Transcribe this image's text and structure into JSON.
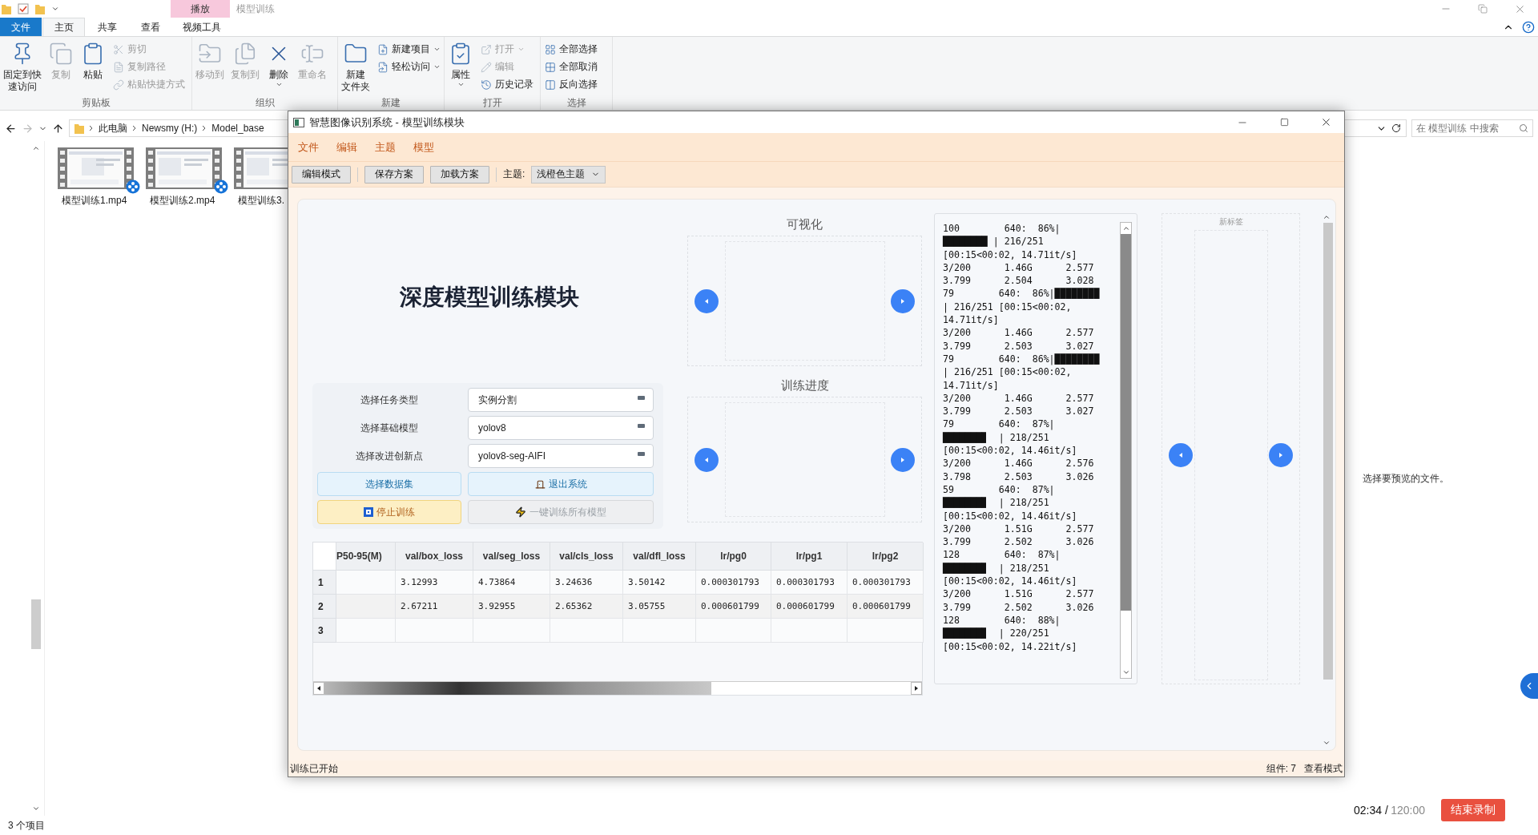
{
  "explorer": {
    "title": "模型训练",
    "context_tab": "播放",
    "tabs": [
      {
        "label": "文件",
        "kind": "file",
        "selected": false
      },
      {
        "label": "主页",
        "kind": "tab",
        "selected": true
      },
      {
        "label": "共享",
        "kind": "tab",
        "selected": false
      },
      {
        "label": "查看",
        "kind": "tab",
        "selected": false
      },
      {
        "label": "视频工具",
        "kind": "tab",
        "selected": false
      }
    ],
    "ribbon_groups": [
      {
        "label": "剪贴板",
        "items": [
          {
            "lines": [
              "固定到快",
              "速访问"
            ],
            "kind": "large",
            "disabled": false,
            "dropdown": false
          },
          {
            "label": "复制",
            "kind": "large",
            "disabled": true,
            "dropdown": false
          },
          {
            "label": "粘贴",
            "kind": "large",
            "disabled": false,
            "dropdown": false
          },
          {
            "label": "剪切",
            "kind": "small",
            "disabled": true,
            "dropdown": false
          },
          {
            "label": "复制路径",
            "kind": "small",
            "disabled": true,
            "dropdown": false
          },
          {
            "label": "粘贴快捷方式",
            "kind": "small",
            "disabled": true,
            "dropdown": false
          }
        ]
      },
      {
        "label": "组织",
        "items": [
          {
            "label": "移动到",
            "kind": "large",
            "disabled": true,
            "dropdown": false
          },
          {
            "label": "复制到",
            "kind": "large",
            "disabled": true,
            "dropdown": false
          },
          {
            "label": "删除",
            "kind": "large",
            "disabled": false,
            "dropdown": true
          },
          {
            "label": "重命名",
            "kind": "large",
            "disabled": true,
            "dropdown": false
          }
        ]
      },
      {
        "label": "新建",
        "items": [
          {
            "lines": [
              "新建",
              "文件夹"
            ],
            "kind": "large",
            "disabled": false,
            "dropdown": false
          },
          {
            "label": "新建项目",
            "kind": "small",
            "disabled": false,
            "dropdown": true
          },
          {
            "label": "轻松访问",
            "kind": "small",
            "disabled": false,
            "dropdown": true
          }
        ]
      },
      {
        "label": "打开",
        "items": [
          {
            "label": "属性",
            "kind": "large",
            "disabled": false,
            "dropdown": true
          },
          {
            "label": "打开",
            "kind": "small",
            "disabled": true,
            "dropdown": true
          },
          {
            "label": "编辑",
            "kind": "small",
            "disabled": true,
            "dropdown": false
          },
          {
            "label": "历史记录",
            "kind": "small",
            "disabled": false,
            "dropdown": false
          }
        ]
      },
      {
        "label": "选择",
        "items": [
          {
            "label": "全部选择",
            "kind": "small",
            "disabled": false,
            "dropdown": false
          },
          {
            "label": "全部取消",
            "kind": "small",
            "disabled": false,
            "dropdown": false
          },
          {
            "label": "反向选择",
            "kind": "small",
            "disabled": false,
            "dropdown": false
          }
        ]
      }
    ],
    "breadcrumbs": [
      "此电脑",
      "Newsmy (H:)",
      "Model_base"
    ],
    "search": {
      "placeholder": "在 模型训练 中搜索"
    },
    "files": [
      {
        "name": "模型训练1.mp4"
      },
      {
        "name": "模型训练2.mp4"
      },
      {
        "name": "模型训练3."
      }
    ],
    "preview_hint": "选择要预览的文件。",
    "status": "3 个项目"
  },
  "app": {
    "title": "智慧图像识别系统 - 模型训练模块",
    "menu": [
      "文件",
      "编辑",
      "主题",
      "模型"
    ],
    "toolbar": {
      "buttons": [
        "编辑模式",
        "保存方案",
        "加载方案"
      ],
      "theme_label": "主题:",
      "theme_value": "浅橙色主题"
    },
    "heading": "深度模型训练模块",
    "form": [
      {
        "label": "选择任务类型",
        "value": "实例分割"
      },
      {
        "label": "选择基础模型",
        "value": "yolov8"
      },
      {
        "label": "选择改进创新点",
        "value": "yolov8-seg-AIFI"
      }
    ],
    "actions": [
      {
        "label": "选择数据集",
        "kind": "info",
        "disabled": false
      },
      {
        "label": "退出系统",
        "kind": "info",
        "disabled": false
      },
      {
        "label": "停止训练",
        "kind": "warning",
        "disabled": false
      },
      {
        "label": "一键训练所有模型",
        "kind": "plain",
        "disabled": true
      }
    ],
    "carousels": [
      {
        "title": "可视化"
      },
      {
        "title": "训练进度"
      }
    ],
    "log": [
      "100        640:  86%|",
      "████████ | 216/251",
      "[00:15<00:02, 14.71it/s]",
      "3/200      1.46G      2.577",
      "3.799      2.504      3.028",
      "79        640:  86%|████████",
      "| 216/251 [00:15<00:02,",
      "14.71it/s]",
      "3/200      1.46G      2.577",
      "3.799      2.503      3.027",
      "79        640:  86%|████████",
      "| 216/251 [00:15<00:02,",
      "14.71it/s]",
      "3/200      1.46G      2.577",
      "3.799      2.503      3.027",
      "79        640:  87%|",
      "███████▊  | 218/251",
      "[00:15<00:02, 14.46it/s]",
      "3/200      1.46G      2.576",
      "3.798      2.503      3.026",
      "59        640:  87%|",
      "███████▊  | 218/251",
      "[00:15<00:02, 14.46it/s]",
      "3/200      1.51G      2.577",
      "3.799      2.502      3.026",
      "128        640:  87%|",
      "███████▊  | 218/251",
      "[00:15<00:02, 14.46it/s]",
      "3/200      1.51G      2.577",
      "3.799      2.502      3.026",
      "128        640:  88%|",
      "███████▊  | 220/251",
      "[00:15<00:02, 14.22it/s]"
    ],
    "tab_panel": {
      "title": "新标签"
    },
    "table": {
      "columns": [
        "P50-95(M)",
        "val/box_loss",
        "val/seg_loss",
        "val/cls_loss",
        "val/dfl_loss",
        "lr/pg0",
        "lr/pg1",
        "lr/pg2"
      ],
      "rows": [
        {
          "header": "1",
          "cells": [
            null,
            "3.12993",
            "4.73864",
            "3.24636",
            "3.50142",
            "0.000301793",
            "0.000301793",
            "0.000301793"
          ]
        },
        {
          "header": "2",
          "cells": [
            null,
            "2.67211",
            "3.92955",
            "2.65362",
            "3.05755",
            "0.000601799",
            "0.000601799",
            "0.000601799"
          ]
        },
        {
          "header": "3"
        }
      ]
    },
    "status": {
      "message": "训练已开始",
      "components": "组件: 7",
      "mode": "查看模式"
    }
  },
  "recording": {
    "elapsed": "02:34 /",
    "limit": "120:00",
    "button": "结束录制"
  }
}
